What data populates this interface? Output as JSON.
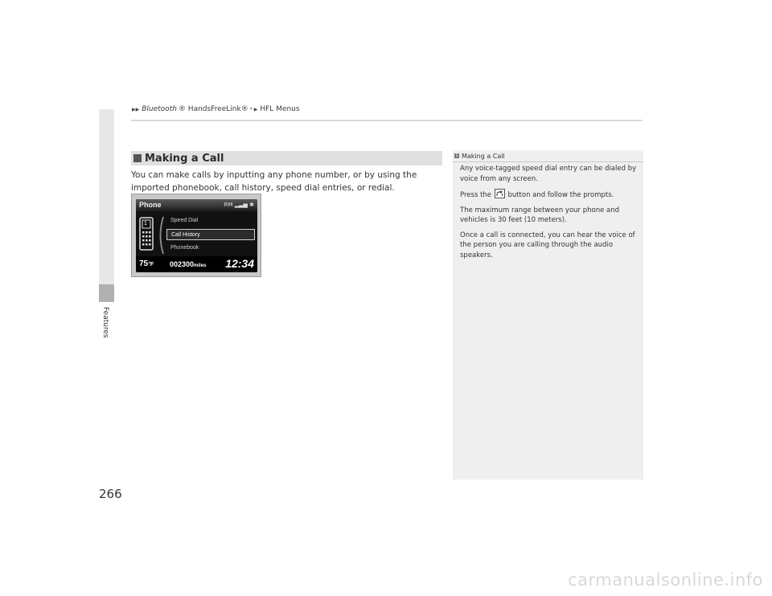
{
  "breadcrumb": {
    "part1": "Bluetooth",
    "part1_suffix": "® HandsFreeLink®",
    "part1_sup": "*",
    "part2": "HFL Menus"
  },
  "sidebar": {
    "label": "Features"
  },
  "section": {
    "title": "Making a Call"
  },
  "body": {
    "paragraph": "You can make calls by inputting any phone number, or by using the imported phonebook, call history, speed dial entries, or redial."
  },
  "screen": {
    "title": "Phone",
    "status_icons": "RM ▂▃▅ ✱",
    "menu": [
      "Speed Dial",
      "Call History",
      "Phonebook"
    ],
    "selected_index": 1,
    "phone_digit": "1",
    "temperature": "75",
    "temperature_unit": "°F",
    "odometer": "002300",
    "odometer_unit": "miles",
    "clock": "12:34"
  },
  "note": {
    "title": "Making a Call",
    "p1": "Any voice-tagged speed dial entry can be dialed by voice from any screen.",
    "p2_pre": "Press the",
    "p2_post": "button and follow the prompts.",
    "p3": "The maximum range between your phone and vehicles is 30 feet (10 meters).",
    "p4": "Once a call is connected, you can hear the voice of the person you are calling through the audio speakers."
  },
  "footer": {
    "page_number": "266",
    "watermark": "carmanualsonline.info"
  }
}
